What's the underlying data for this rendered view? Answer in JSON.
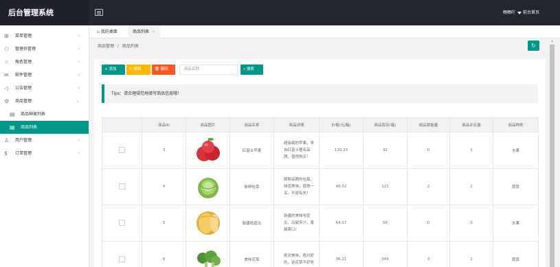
{
  "app": {
    "title": "后台管理系统",
    "user": "畅畅吖",
    "home_link": "前台首页"
  },
  "sidebar": {
    "items": [
      {
        "icon": "grid-icon",
        "label": "菜单管理"
      },
      {
        "icon": "admin-user-icon",
        "label": "管理员管理"
      },
      {
        "icon": "star-icon",
        "label": "角色管理"
      },
      {
        "icon": "mail-icon",
        "label": "邮件管理"
      },
      {
        "icon": "speaker-icon",
        "label": "公告管理"
      },
      {
        "icon": "goods-icon",
        "label": "商品管理"
      },
      {
        "icon": "doc-icon",
        "label": "商品种类列表"
      },
      {
        "icon": "doc-icon",
        "label": "商品列表"
      },
      {
        "icon": "user-icon",
        "label": "用户管理"
      },
      {
        "icon": "dollar-icon",
        "label": "订单管理"
      }
    ]
  },
  "tabs": {
    "home": "我的桌面",
    "products": "商品列表"
  },
  "breadcrumb": {
    "level1": "商品管理",
    "sep": "/",
    "level2": "商品列表"
  },
  "toolbar": {
    "add_label": "+ 添加",
    "edit_label": "编辑",
    "delete_label": "删除",
    "search_placeholder": "商品名称",
    "search_label": "搜索"
  },
  "tips": "Tips：请合理规范地填写商品信息哦！",
  "table": {
    "headers": [
      "",
      "商品ID",
      "商品图片",
      "商品名称",
      "商品详情",
      "价格(元/箱)",
      "商品库存(箱)",
      "商品销售量",
      "商品评论量",
      "商品种类"
    ],
    "rows": [
      {
        "id": "3",
        "image": "apple",
        "name": "红富士苹果",
        "detail": [
          "超级甜的苹果，来",
          "自红富士著名品",
          "牌，值得购买！"
        ],
        "price": "120.23",
        "stock": "32",
        "sales": "0",
        "comments": "1",
        "category": "水果"
      },
      {
        "id": "4",
        "image": "cabbage",
        "name": "新鲜包菜",
        "detail": [
          "刚刚采摘的包菜，",
          "味道美味，值得一",
          "买，不容有失！"
        ],
        "price": "46.32",
        "stock": "121",
        "sales": "2",
        "comments": "1",
        "category": "蔬菜"
      },
      {
        "id": "5",
        "image": "melon",
        "name": "新疆哈密瓜",
        "detail": [
          "新疆的美味哈密",
          "瓜，瓜甜多汁，香",
          "甜爽口！"
        ],
        "price": "64.17",
        "stock": "56",
        "sales": "0",
        "comments": "0",
        "category": "水果"
      },
      {
        "id": "6",
        "image": "broccoli",
        "name": "美味花菜",
        "detail": [
          "绝对美味，绝对好",
          "吃，这花菜不好吃"
        ],
        "price": "36.21",
        "stock": "349",
        "sales": "3",
        "comments": "1",
        "category": "蔬菜"
      }
    ]
  },
  "colors": {
    "primary": "#009688",
    "warn": "#ffb800",
    "danger": "#ff5722",
    "topbar": "#23262e"
  }
}
